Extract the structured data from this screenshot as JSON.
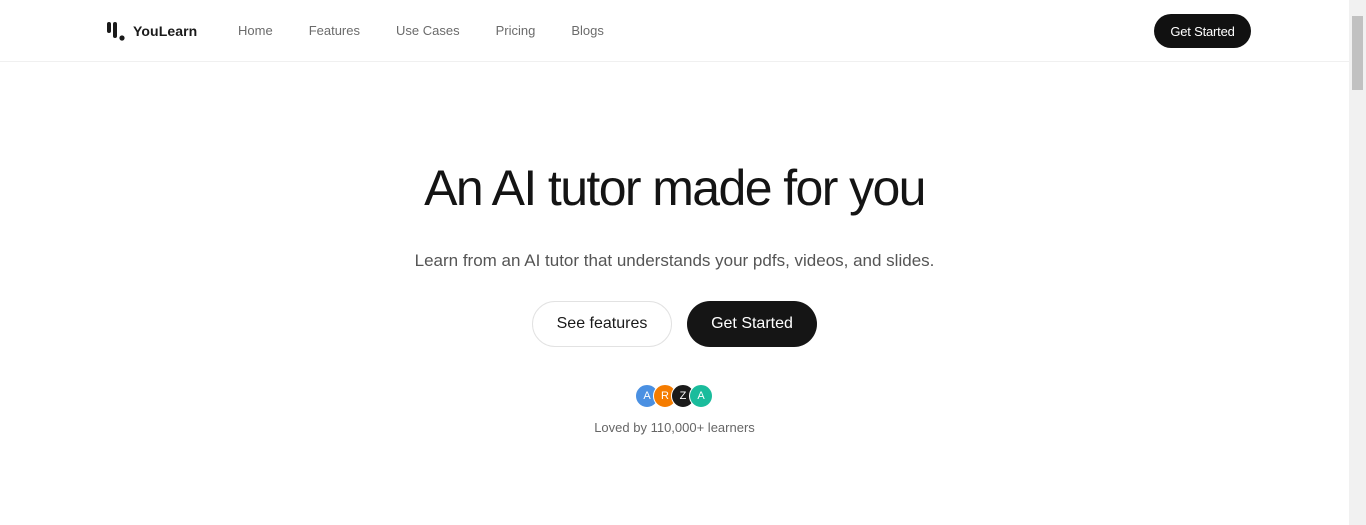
{
  "brand": {
    "name": "YouLearn"
  },
  "nav": {
    "items": [
      {
        "label": "Home"
      },
      {
        "label": "Features"
      },
      {
        "label": "Use Cases"
      },
      {
        "label": "Pricing"
      },
      {
        "label": "Blogs"
      }
    ],
    "cta_label": "Get Started"
  },
  "hero": {
    "title": "An AI tutor made for you",
    "subtitle": "Learn from an AI tutor that understands your pdfs, videos, and slides.",
    "secondary_button": "See features",
    "primary_button": "Get Started"
  },
  "social_proof": {
    "avatars": [
      {
        "initial": "A",
        "color": "#4a90e2"
      },
      {
        "initial": "R",
        "color": "#f57c00"
      },
      {
        "initial": "Z",
        "color": "#1a1a1a"
      },
      {
        "initial": "A",
        "color": "#1abc9c"
      }
    ],
    "text": "Loved by 110,000+ learners"
  },
  "colors": {
    "primary": "#111111",
    "text_muted": "#6b6b6b"
  }
}
